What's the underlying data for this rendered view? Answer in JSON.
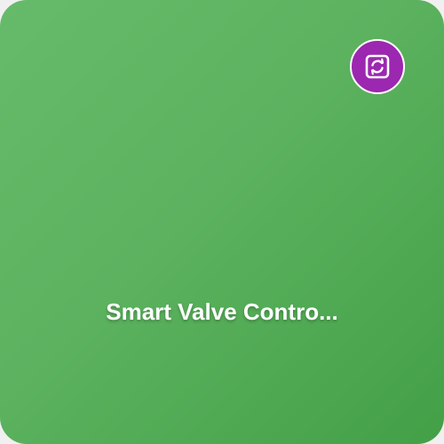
{
  "tile": {
    "title": "Smart Valve Contro...",
    "background_gradient": [
      "#66bb6a",
      "#43a047"
    ],
    "badge": {
      "icon": "sync-icon",
      "color": "#9c27b0"
    }
  }
}
